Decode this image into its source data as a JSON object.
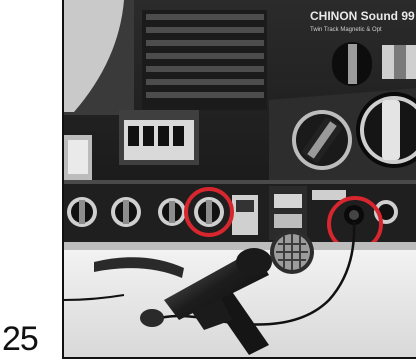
{
  "page": {
    "number": "25"
  },
  "device": {
    "brand": "CHINON Sound",
    "model_partial": "99",
    "subtitle": "Twin Track Magnetic & Opt"
  },
  "highlights": {
    "color": "#d8262e"
  }
}
